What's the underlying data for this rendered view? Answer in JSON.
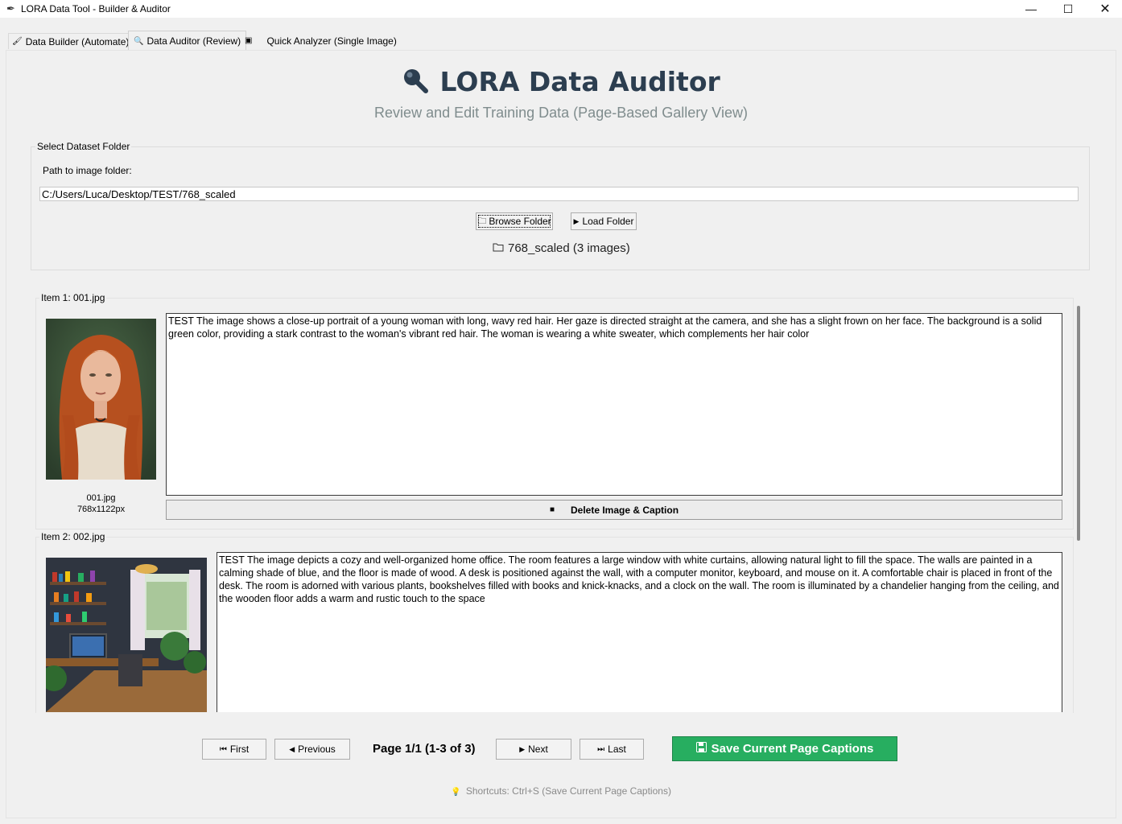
{
  "window": {
    "title": "LORA Data Tool - Builder & Auditor",
    "minimize": "—",
    "maximize": "☐",
    "close": "✕"
  },
  "tabs": [
    {
      "label": "Data Builder (Automate)",
      "icon": "wand-icon"
    },
    {
      "label": "Data Auditor (Review)",
      "icon": "magnifier-icon"
    },
    {
      "label": "Quick Analyzer (Single Image)",
      "icon": "picture-icon"
    }
  ],
  "header": {
    "title": "LORA Data Auditor",
    "subtitle": "Review and Edit Training Data (Page-Based Gallery View)",
    "title_color": "#2c3e50",
    "subtitle_color": "#7f8c8d"
  },
  "dataset": {
    "legend": "Select Dataset Folder",
    "path_label": "Path to image folder:",
    "path_value": "C:/Users/Luca/Desktop/TEST/768_scaled",
    "browse_label": "Browse Folder",
    "load_label": "Load Folder",
    "status": "768_scaled (3 images)"
  },
  "items": [
    {
      "legend": "Item 1: 001.jpg",
      "filename": "001.jpg",
      "dimensions": "768x1122px",
      "caption": "TEST The image shows a close-up portrait of a young woman with long, wavy red hair. Her gaze is directed straight at the camera, and she has a slight frown on her face. The background is a solid green color, providing a stark contrast to the woman's vibrant red hair. The woman is wearing a white sweater, which complements her hair color",
      "delete_label": "Delete Image & Caption"
    },
    {
      "legend": "Item 2: 002.jpg",
      "caption": "TEST The image depicts a cozy and well-organized home office. The room features a large window with white curtains, allowing natural light to fill the space. The walls are painted in a calming shade of blue, and the floor is made of wood. A desk is positioned against the wall, with a computer monitor, keyboard, and mouse on it. A comfortable chair is placed in front of the desk. The room is adorned with various plants, bookshelves filled with books and knick-knacks, and a clock on the wall. The room is illuminated by a chandelier hanging from the ceiling, and the wooden floor adds a warm and rustic touch to the space"
    }
  ],
  "pagination": {
    "first_label": "First",
    "previous_label": "Previous",
    "page_info": "Page 1/1 (1-3 of 3)",
    "next_label": "Next",
    "last_label": "Last",
    "save_label": "Save Current Page Captions",
    "save_color": "#27ae60"
  },
  "shortcuts": "Shortcuts: Ctrl+S (Save Current Page Captions)"
}
